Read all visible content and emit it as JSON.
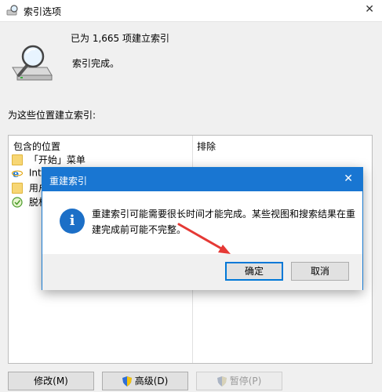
{
  "window": {
    "title": "索引选项",
    "close_glyph": "✕"
  },
  "status": {
    "count_text": "已为 1,665 项建立索引",
    "state_text": "索引完成。"
  },
  "locations": {
    "section_label": "为这些位置建立索引:",
    "columns": {
      "included": "包含的位置",
      "excluded": "排除"
    },
    "rows": [
      {
        "label": "「开始」菜单",
        "icon": "folder-icon"
      },
      {
        "label": "Inter",
        "icon": "internet-explorer-icon"
      },
      {
        "label": "用户",
        "icon": "folder-icon"
      },
      {
        "label": "脱机",
        "icon": "offline-files-icon"
      }
    ]
  },
  "buttons": {
    "modify": "修改(M)",
    "advanced": "高级(D)",
    "pause": "暂停(P)"
  },
  "dialog": {
    "title": "重建索引",
    "close_glyph": "✕",
    "message": "重建索引可能需要很长时间才能完成。某些视图和搜索结果在重建完成前可能不完整。",
    "ok": "确定",
    "cancel": "取消",
    "accent_color": "#1976d2"
  },
  "annotation": {
    "arrow_color": "#e53935"
  }
}
